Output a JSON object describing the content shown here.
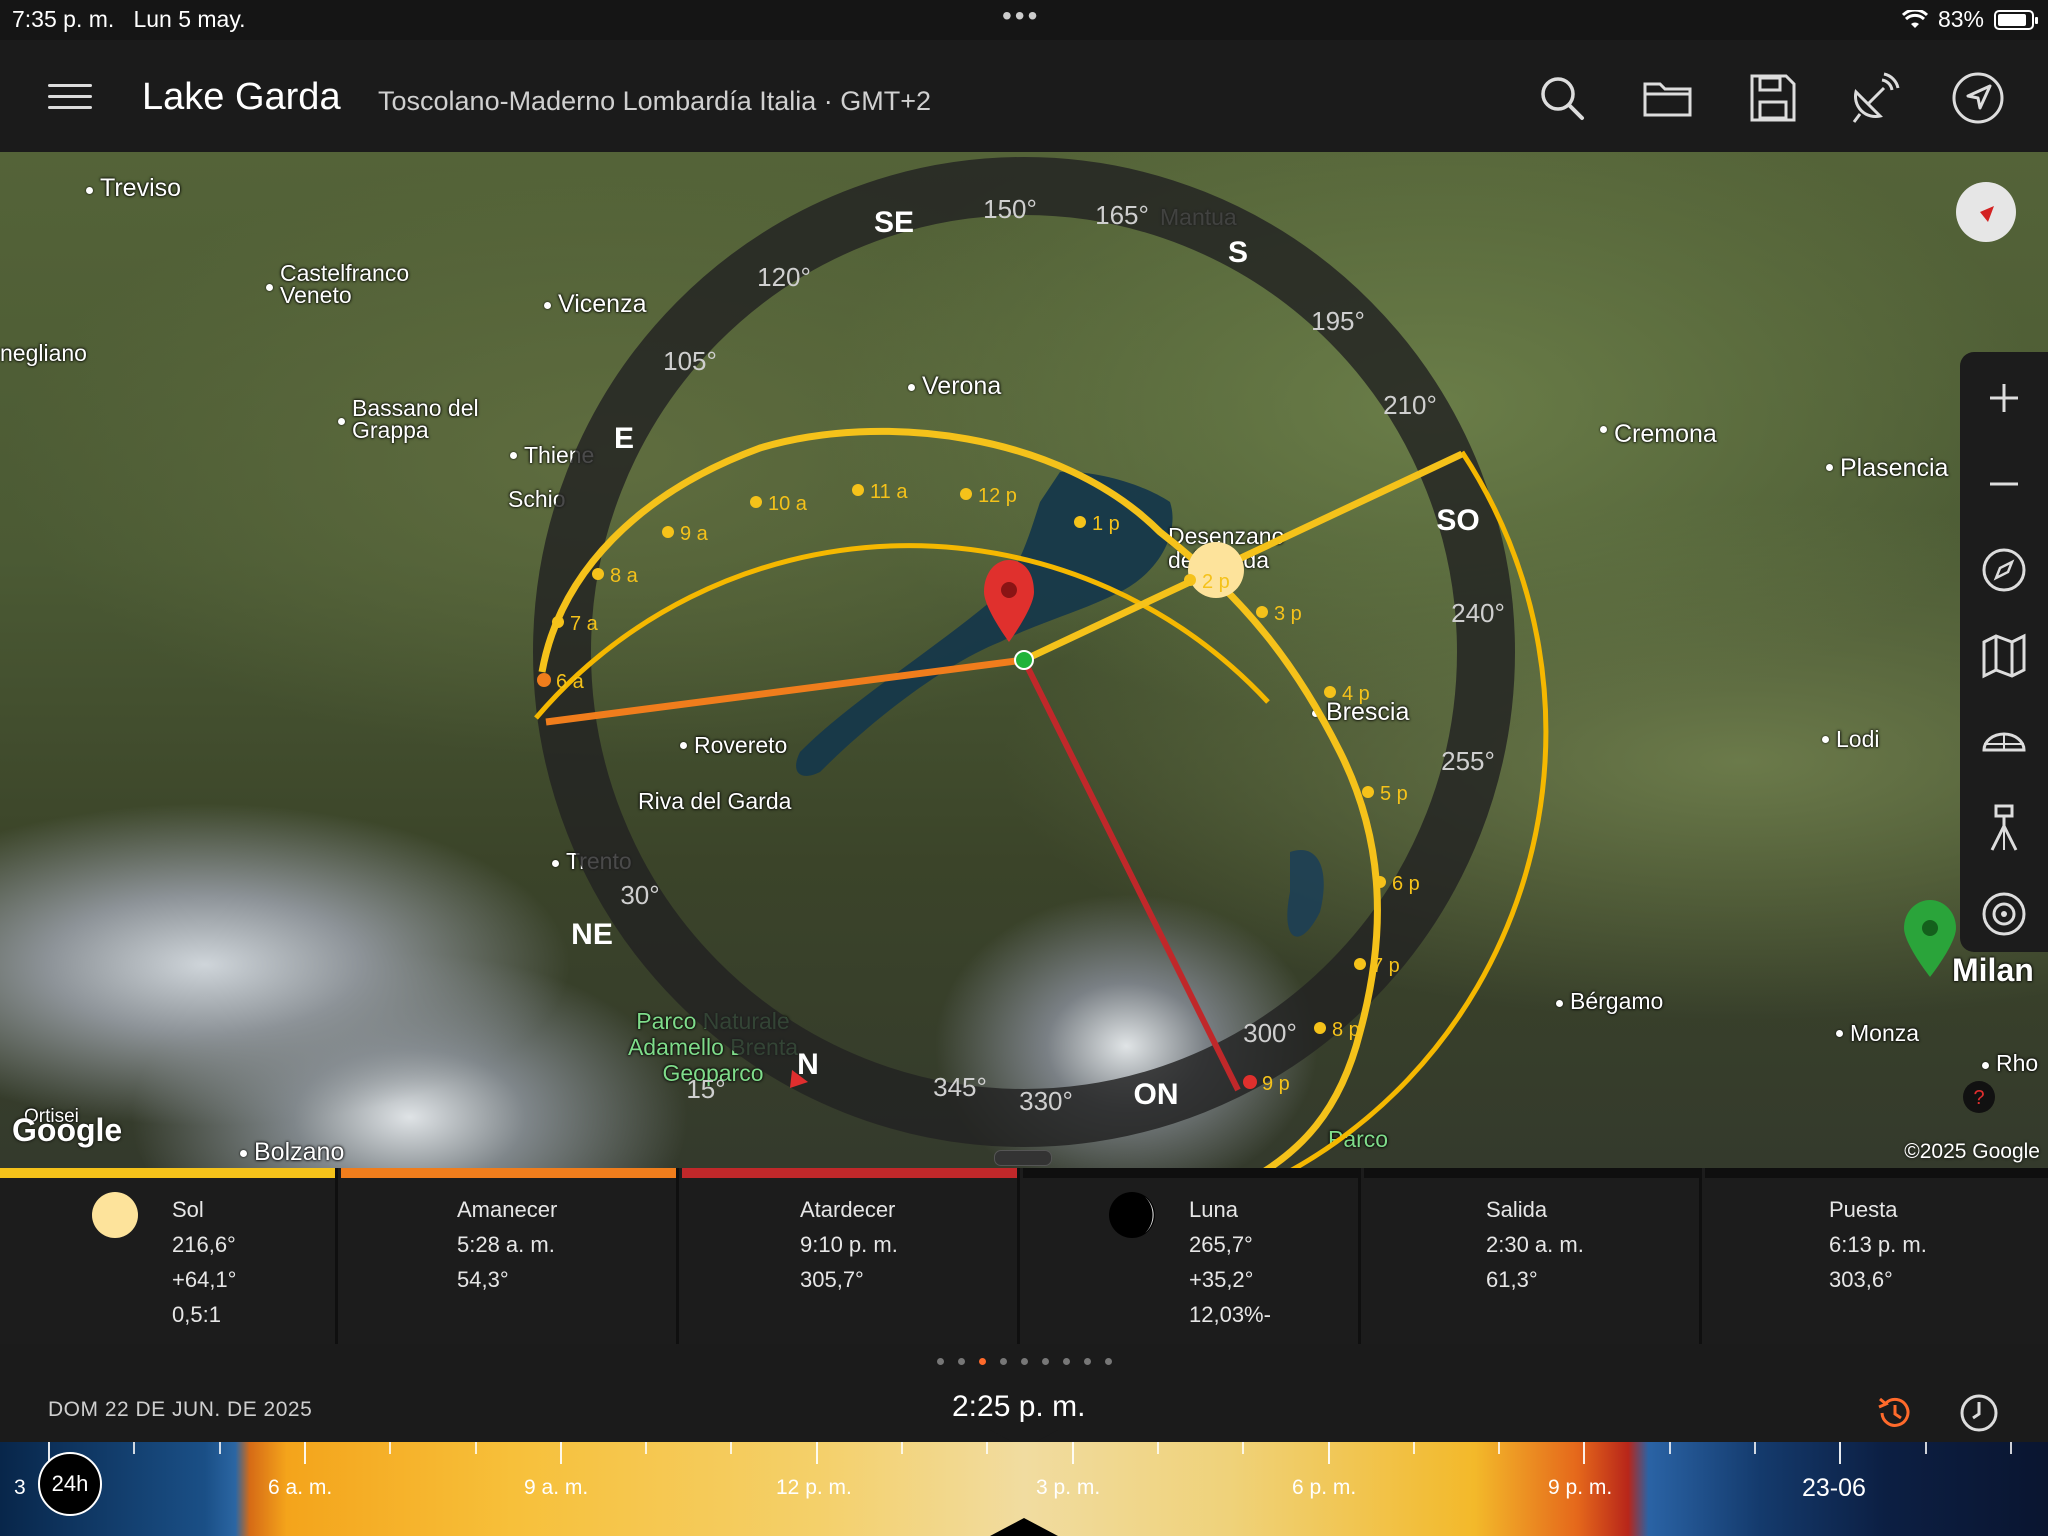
{
  "status_bar": {
    "time": "7:35 p. m.",
    "date": "Lun 5 may.",
    "battery": "83%",
    "battery_level": 0.83,
    "dots": "•••"
  },
  "header": {
    "title": "Lake Garda",
    "subtitle": "Toscolano-Maderno Lombardía Italia · GMT+2",
    "icons": [
      "menu-icon",
      "search-icon",
      "folder-icon",
      "save-icon",
      "satellite-dish-icon",
      "navigation-arrow-icon"
    ]
  },
  "map": {
    "cities": [
      "Treviso",
      "Castelfranco Veneto",
      "Vicenza",
      "negliano",
      "Verona",
      "Bassano del Grappa",
      "Thiene",
      "Schio",
      "Cremona",
      "Plasencia",
      "Desenzano del Garda",
      "Brescia",
      "Rovereto",
      "Riva del Garda",
      "Trento",
      "Lodi",
      "Bérgamo",
      "Milan",
      "Monza",
      "Rho",
      "Bolzano",
      "Ortisei",
      "Parco Naturale Adamello Brenta Geoparco",
      "Parco",
      "Mantua"
    ],
    "attribution": "Google",
    "copyright": "©2025 Google",
    "compass_degrees": [
      "150°",
      "165°",
      "195°",
      "210°",
      "240°",
      "255°",
      "300°",
      "330°",
      "345°",
      "15°",
      "30°",
      "105°",
      "120°"
    ],
    "compass_dirs": [
      "SE",
      "S",
      "SO",
      "ON",
      "N",
      "NE",
      "E"
    ],
    "sun_hours": [
      "6 a",
      "7 a",
      "8 a",
      "9 a",
      "10 a",
      "11 a",
      "12 p",
      "1 p",
      "2 p",
      "3 p",
      "4 p",
      "5 p",
      "6 p",
      "7 p",
      "8 p",
      "9 p"
    ],
    "colors": {
      "sun_path": "#f5b800",
      "sunrise_line": "#f07d1c",
      "sunset_line": "#c0282a",
      "sun_line": "#f5c21a",
      "pin": "#e0302d",
      "milan_pin": "#2aa43a"
    }
  },
  "right_panel": {
    "icons": [
      "plus-icon",
      "minus-icon",
      "compass-icon",
      "map-icon",
      "globe-icon",
      "tripod-icon",
      "target-icon"
    ]
  },
  "info": {
    "sun": {
      "label": "Sol",
      "azimuth": "216,6°",
      "elevation": "+64,1°",
      "ratio": "0,5:1",
      "color": "#f5c21a"
    },
    "sunrise": {
      "label": "Amanecer",
      "time": "5:28 a. m.",
      "azimuth": "54,3°",
      "color": "#f07d1c"
    },
    "sunset": {
      "label": "Atardecer",
      "time": "9:10 p. m.",
      "azimuth": "305,7°",
      "color": "#c0282a"
    },
    "moon": {
      "label": "Luna",
      "azimuth": "265,7°",
      "elevation": "+35,2°",
      "illumination": "12,03%-"
    },
    "moonrise": {
      "label": "Salida",
      "time": "2:30 a. m.",
      "azimuth": "61,3°"
    },
    "moonset": {
      "label": "Puesta",
      "time": "6:13 p. m.",
      "azimuth": "303,6°"
    }
  },
  "pager": {
    "count": 9,
    "active": 2
  },
  "timebar": {
    "date": "DOM 22 DE JUN. DE 2025",
    "time": "2:25 p. m.",
    "icons": [
      "history-icon",
      "clock-icon"
    ]
  },
  "timeline": {
    "labels": [
      "6 a. m.",
      "9 a. m.",
      "12 p. m.",
      "3 p. m.",
      "6 p. m.",
      "9 p. m."
    ],
    "next_date": "23-06",
    "left_edge": "3",
    "toggle": "24h"
  }
}
